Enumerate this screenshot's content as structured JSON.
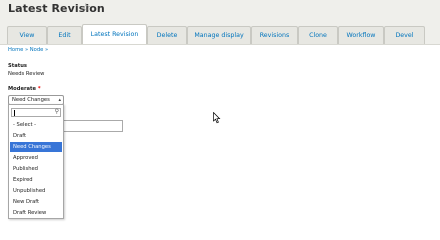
{
  "header": {
    "title": "Latest Revision",
    "star_icon": "star-outline-icon"
  },
  "tabs": [
    {
      "label": "View"
    },
    {
      "label": "Edit"
    },
    {
      "label": "Latest Revision",
      "active": true
    },
    {
      "label": "Delete"
    },
    {
      "label": "Manage display"
    },
    {
      "label": "Revisions"
    },
    {
      "label": "Clone"
    },
    {
      "label": "Workflow"
    },
    {
      "label": "Devel"
    }
  ],
  "breadcrumb": "Home » Node »",
  "status": {
    "label": "Status",
    "value": "Needs Review"
  },
  "moderate": {
    "label": "Moderate",
    "required_mark": "*",
    "selected_value": "Need Changes",
    "search_value": "",
    "options": [
      "- Select -",
      "Draft",
      "Need Changes",
      "Approved",
      "Published",
      "Expired",
      "Unpublished",
      "New Draft",
      "Draft Review"
    ],
    "highlighted_option": "Need Changes"
  },
  "colors": {
    "link": "#0074bd",
    "highlight": "#3875d7",
    "header_bg": "#efefeb"
  }
}
